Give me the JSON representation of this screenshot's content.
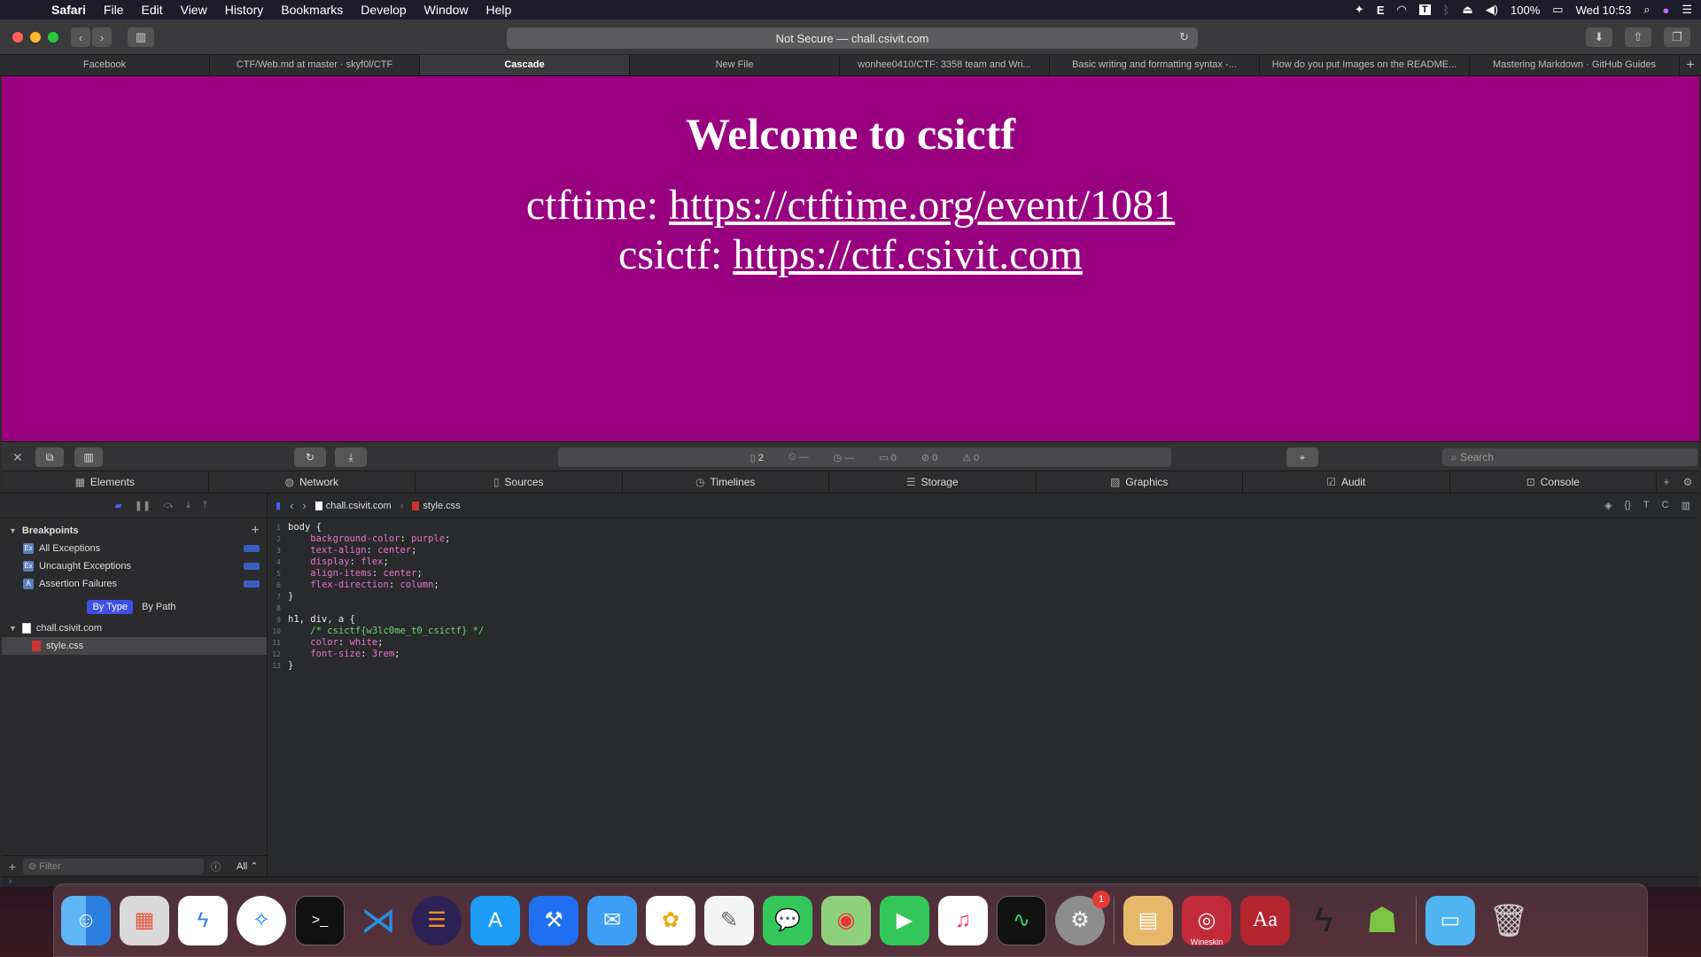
{
  "menubar": {
    "app_name": "Safari",
    "items": [
      "File",
      "Edit",
      "View",
      "History",
      "Bookmarks",
      "Develop",
      "Window",
      "Help"
    ],
    "status_letter": "E",
    "status_T": "T",
    "battery": "100%",
    "clock": "Wed 10:53"
  },
  "toolbar": {
    "address": "Not Secure — chall.csivit.com"
  },
  "tabs": [
    "Facebook",
    "CTF/Web.md at master · skyf0l/CTF",
    "Cascade",
    "New File",
    "wonhee0410/CTF: 3358 team and Wri...",
    "Basic writing and formatting syntax -...",
    "How do you put Images on the README...",
    "Mastering Markdown · GitHub Guides"
  ],
  "page": {
    "heading": "Welcome to csictf",
    "ctftime_label": "ctftime: ",
    "ctftime_link": "https://ctftime.org/event/1081",
    "csictf_label": "csictf: ",
    "csictf_link": "https://ctf.csivit.com",
    "background_color": "#990080"
  },
  "devtools": {
    "status": {
      "resources": "2",
      "errors": "0",
      "warnings": "0",
      "logs": "0"
    },
    "search_placeholder": "Search",
    "tabs": [
      "Elements",
      "Network",
      "Sources",
      "Timelines",
      "Storage",
      "Graphics",
      "Audit",
      "Console"
    ],
    "sidebar": {
      "breakpoints_title": "Breakpoints",
      "breakpoints": [
        "All Exceptions",
        "Uncaught Exceptions",
        "Assertion Failures"
      ],
      "by_type": "By Type",
      "by_path": "By Path",
      "domain": "chall.csivit.com",
      "file": "style.css",
      "filter_placeholder": "Filter",
      "filter_all": "All"
    },
    "editor": {
      "crumb_domain": "chall.csivit.com",
      "crumb_file": "style.css"
    }
  },
  "dock": {
    "wineskin_label": "Wineskin",
    "settings_badge": "1"
  }
}
